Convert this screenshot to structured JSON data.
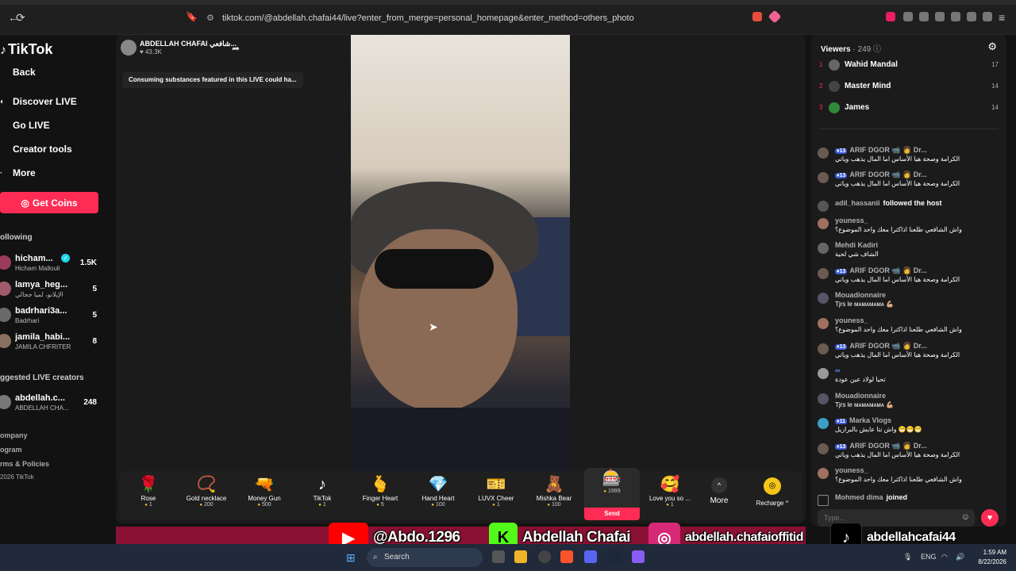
{
  "browser": {
    "url": "tiktok.com/@abdellah.chafai44/live?enter_from_merge=personal_homepage&enter_method=others_photo"
  },
  "sidebar": {
    "logo": "TikTok",
    "items": [
      {
        "label": "Back"
      },
      {
        "label": "Discover LIVE"
      },
      {
        "label": "Go LIVE"
      },
      {
        "label": "Creator tools"
      },
      {
        "label": "More"
      }
    ],
    "coins_button": "Get Coins",
    "following_title": "ollowing",
    "following": [
      {
        "name": "hicham...",
        "sub": "Hicham Mallouli",
        "count": "1.5K"
      },
      {
        "name": "lamya_heg...",
        "sub": "الإيلانو، لميا ججالي",
        "count": "5"
      },
      {
        "name": "badrhari3a...",
        "sub": "Badrhari",
        "count": "5"
      },
      {
        "name": "jamila_habi...",
        "sub": "JAMILA CHFRITER",
        "count": "8"
      }
    ],
    "suggested_title": "ggested LIVE creators",
    "suggested": [
      {
        "name": "abdellah.c...",
        "sub": "ABDELLAH CHA...",
        "count": "248"
      }
    ],
    "footer": [
      "ompany",
      "ogram",
      "rms & Policies",
      "2026 TikTok"
    ]
  },
  "live": {
    "host_name": "ABDELLAH CHAFAI شافعي...",
    "host_likes": "43.3K",
    "warning": "Consuming substances featured in this LIVE could ha...",
    "gifts": [
      {
        "icon": "🌹",
        "name": "Rose",
        "price": "1"
      },
      {
        "icon": "📿",
        "name": "Gold necklace",
        "price": "200"
      },
      {
        "icon": "🔫",
        "name": "Money Gun",
        "price": "500"
      },
      {
        "icon": "♪",
        "name": "TikTok",
        "price": "1"
      },
      {
        "icon": "🫰",
        "name": "Finger Heart",
        "price": "5"
      },
      {
        "icon": "💎",
        "name": "Hand Heart",
        "price": "100"
      },
      {
        "icon": "🎫",
        "name": "LUVX Cheer",
        "price": "1"
      },
      {
        "icon": "🧸",
        "name": "Mishka Bear",
        "price": "100"
      },
      {
        "icon": "🎰",
        "name": "",
        "price": "1999",
        "send": "Send"
      },
      {
        "icon": "🥰",
        "name": "Love you so ...",
        "price": "1"
      }
    ],
    "more_label": "More",
    "recharge_label": "Recharge ^"
  },
  "chat": {
    "viewers_label": "Viewers",
    "viewers_count": "· 249",
    "ranks": [
      {
        "rank": "1",
        "name": "Wahid Mandal",
        "score": "17"
      },
      {
        "rank": "2",
        "name": "Master Mind",
        "score": "14"
      },
      {
        "rank": "3",
        "name": "James",
        "score": "14"
      }
    ],
    "messages": [
      {
        "level": "13",
        "user": "ARIF DGOR 📹 👩 Dr...",
        "text": "الكرامة وصحة هيا الأساس اما المال يذهب وياتي"
      },
      {
        "level": "13",
        "user": "ARIF DGOR 📹 👩 Dr...",
        "text": "الكرامة وصحة هيا الأساس اما المال يذهب وياتي"
      },
      {
        "level": "",
        "user": "adil_hassanii",
        "inline": "followed the host",
        "text": ""
      },
      {
        "level": "",
        "user": "youness_",
        "text": "واش الشافعي طلعنا اذاكترا معك واحد الموضوع؟"
      },
      {
        "level": "",
        "user": "Mehdi Kadiri",
        "text": "الشاف شي لحية"
      },
      {
        "level": "13",
        "user": "ARIF DGOR 📹 👩 Dr...",
        "text": "الكرامة وصحة هيا الأساس اما المال يذهب وياتي"
      },
      {
        "level": "",
        "user": "Mouadionnaire",
        "text": "Tjrs le ᴍᴀᴍᴀᴍᴀᴍᴀ 💪🏼"
      },
      {
        "level": "",
        "user": "youness_",
        "text": "واش الشافعي طلعنا اذاكترا معك واحد الموضوع؟"
      },
      {
        "level": "13",
        "user": "ARIF DGOR 📹 👩 Dr...",
        "text": "الكرامة وصحة هيا الأساس اما المال يذهب وياتي"
      },
      {
        "level": "",
        "user": "∞",
        "text": "تحيا لولاد عين عودة"
      },
      {
        "level": "",
        "user": "Mouadionnaire",
        "text": "Tjrs le ᴍᴀᴍᴀᴍᴀᴍᴀ 💪🏼"
      },
      {
        "level": "11",
        "user": "Marka Vlogs",
        "text": "واش نتا عايش بالبرازيل 😁😁😁"
      },
      {
        "level": "13",
        "user": "ARIF DGOR 📹 👩 Dr...",
        "text": "الكرامة وصحة هيا الأساس اما المال يذهب وياتي"
      },
      {
        "level": "",
        "user": "youness_",
        "text": "واش الشافعي طلعنا اذاكترا معك واحد الموضوع؟"
      },
      {
        "level": "",
        "user": "Mohmed dima",
        "inline": "joined",
        "text": ""
      }
    ],
    "input_placeholder": "Type..."
  },
  "overlay": {
    "youtube": "@Abdo.1296",
    "kick": "Abdellah Chafai",
    "instagram": "abdellah.chafaioffitid",
    "tiktok": "abdellahcafai44"
  },
  "taskbar": {
    "search": "Search",
    "lang": "ENG",
    "time": "1:59 AM",
    "date": "8/22/2026"
  },
  "colors": {
    "accent": "#fe2c55",
    "coin": "#f5c518",
    "level_badge": "#3b5bd9"
  }
}
